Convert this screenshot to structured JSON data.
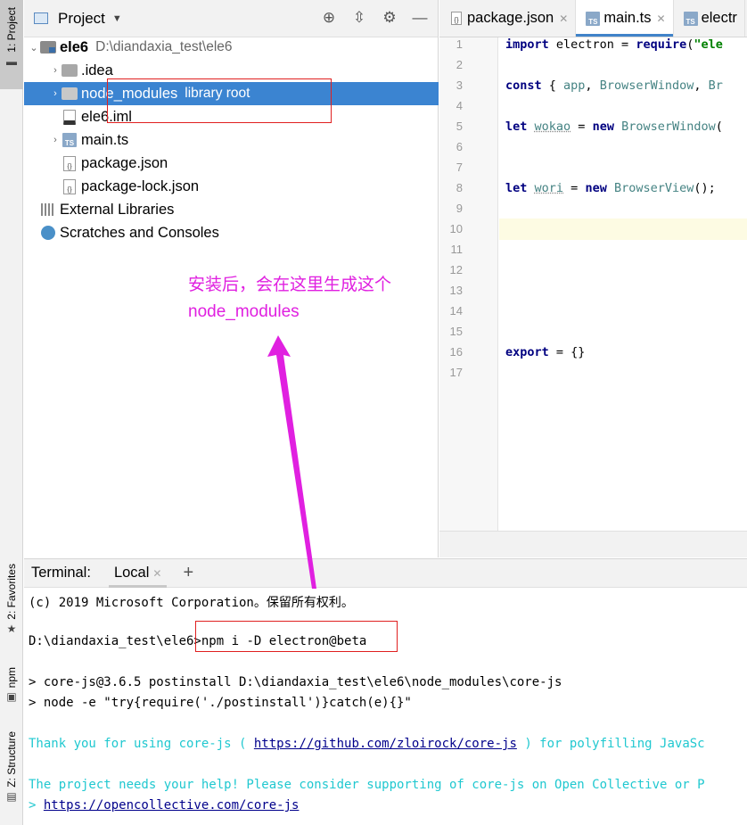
{
  "left_strip": {
    "project_tab": "1: Project",
    "favorites_tab": "2: Favorites",
    "npm_tab": "npm",
    "structure_tab": "Z: Structure"
  },
  "project": {
    "title": "Project",
    "tree": [
      {
        "label": "ele6",
        "sub": "D:\\diandaxia_test\\ele6"
      },
      {
        "label": ".idea"
      },
      {
        "label": "node_modules",
        "sub": "library root"
      },
      {
        "label": "ele6.iml"
      },
      {
        "label": "main.ts"
      },
      {
        "label": "package.json"
      },
      {
        "label": "package-lock.json"
      },
      {
        "label": "External Libraries"
      },
      {
        "label": "Scratches and Consoles"
      }
    ]
  },
  "editor": {
    "tabs": [
      "package.json",
      "main.ts",
      "electr"
    ],
    "line_numbers": [
      "1",
      "2",
      "3",
      "4",
      "5",
      "6",
      "7",
      "8",
      "9",
      "10",
      "11",
      "12",
      "13",
      "14",
      "15",
      "16",
      "17"
    ],
    "code": {
      "l1_kw": "import",
      "l1_rest": " electron = ",
      "l1_req": "require",
      "l1_paren": "(",
      "l1_str": "\"ele",
      "l3_kw": "const",
      "l3_rest": " { ",
      "l3_a": "app",
      "l3_sep": ", ",
      "l3_b": "BrowserWindow",
      "l3_sep2": ", ",
      "l3_c": "Br",
      "l5_kw": "let",
      "l5_var": "wokao",
      "l5_eq": " = ",
      "l5_new": "new",
      "l5_cls": "BrowserWindow",
      "l8_kw": "let",
      "l8_var": "wori",
      "l8_eq": " = ",
      "l8_new": "new",
      "l8_cls": "BrowserView",
      "l8_end": "();",
      "l16_kw": "export",
      "l16_rest": " = {}"
    }
  },
  "terminal": {
    "label": "Terminal:",
    "tab": "Local",
    "lines": {
      "copyright": "(c) 2019 Microsoft Corporation。保留所有权利。",
      "prompt": "D:\\diandaxia_test\\ele6>",
      "command": "npm i -D electron@beta",
      "post1": "> core-js@3.6.5 postinstall D:\\diandaxia_test\\ele6\\node_modules\\core-js",
      "post2": "> node -e \"try{require('./postinstall')}catch(e){}\"",
      "thanks_pre": "Thank you for using core-js ( ",
      "thanks_link": "https://github.com/zloirock/core-js",
      "thanks_post": " ) for polyfilling JavaSc",
      "help": "The project needs your help! Please consider supporting of core-js on Open Collective or P",
      "oc_pre": "> ",
      "oc_link": "https://opencollective.com/core-js"
    }
  },
  "annotation": {
    "line1": "安装后，会在这里生成这个",
    "line2": "node_modules",
    "color": "#e020e0"
  }
}
